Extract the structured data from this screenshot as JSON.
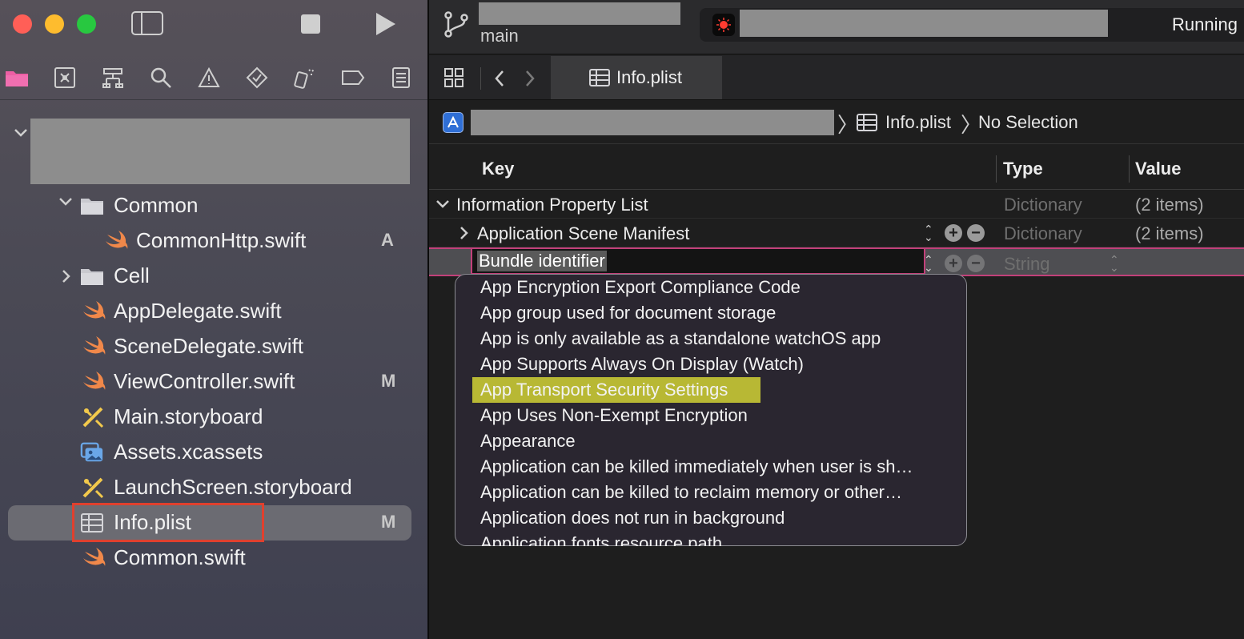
{
  "toolbar": {
    "branch": "main",
    "status": "Running"
  },
  "sidebar": {
    "tree": [
      {
        "label": "Common",
        "badge": ""
      },
      {
        "label": "CommonHttp.swift",
        "badge": "A"
      },
      {
        "label": "Cell",
        "badge": ""
      },
      {
        "label": "AppDelegate.swift",
        "badge": ""
      },
      {
        "label": "SceneDelegate.swift",
        "badge": ""
      },
      {
        "label": "ViewController.swift",
        "badge": "M"
      },
      {
        "label": "Main.storyboard",
        "badge": ""
      },
      {
        "label": "Assets.xcassets",
        "badge": ""
      },
      {
        "label": "LaunchScreen.storyboard",
        "badge": ""
      },
      {
        "label": "Info.plist",
        "badge": "M"
      },
      {
        "label": "Common.swift",
        "badge": ""
      }
    ]
  },
  "editor": {
    "tab": "Info.plist",
    "breadcrumb": {
      "file": "Info.plist",
      "selection": "No Selection"
    },
    "columns": {
      "key": "Key",
      "type": "Type",
      "value": "Value"
    },
    "rows": [
      {
        "key": "Information Property List",
        "type": "Dictionary",
        "value": "(2 items)"
      },
      {
        "key": "Application Scene Manifest",
        "type": "Dictionary",
        "value": "(2 items)"
      },
      {
        "key": "Bundle identifier",
        "type": "String",
        "value": ""
      }
    ],
    "suggestions": [
      "App Encryption Export Compliance Code",
      "App group used for document storage",
      "App is only available as a standalone watchOS app",
      "App Supports Always On Display (Watch)",
      "App Transport Security Settings",
      "App Uses Non-Exempt Encryption",
      "Appearance",
      "Application can be killed immediately when user is sh…",
      "Application can be killed to reclaim memory or other…",
      "Application does not run in background",
      "Application fonts resource path"
    ]
  }
}
